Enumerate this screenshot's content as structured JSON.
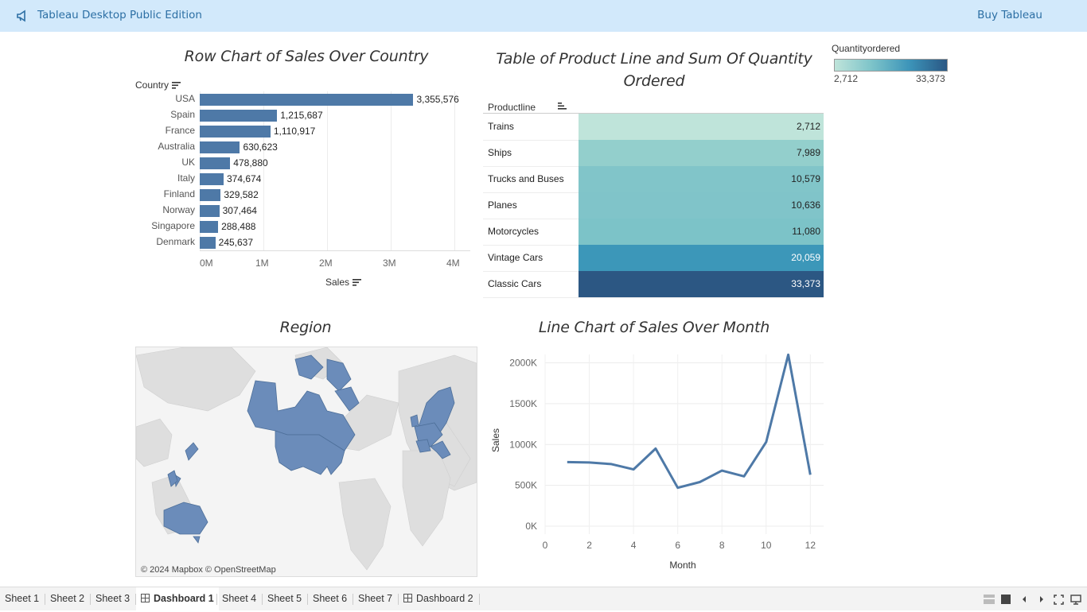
{
  "app": {
    "title": "Tableau Desktop Public Edition",
    "buy_label": "Buy Tableau",
    "brand_icon": "megaphone-icon"
  },
  "bar_chart": {
    "title": "Row Chart of Sales Over Country",
    "row_header": "Country",
    "x_label": "Sales",
    "ticks": [
      "0M",
      "1M",
      "2M",
      "3M",
      "4M"
    ]
  },
  "table": {
    "title_line1": "Table of Product Line and Sum Of Quantity",
    "title_line2": "Ordered",
    "column_header": "Productline",
    "legend_title": "Quantityordered",
    "legend_min": "2,712",
    "legend_max": "33,373"
  },
  "map": {
    "title": "Region",
    "credit": "© 2024 Mapbox © OpenStreetMap",
    "highlight_color": "#6b8cba"
  },
  "line_chart": {
    "title": "Line Chart of Sales Over Month",
    "x_label": "Month",
    "y_label": "Sales",
    "y_ticks": [
      "2000K",
      "1500K",
      "1000K",
      "500K",
      "0K"
    ],
    "x_ticks": [
      "0",
      "2",
      "4",
      "6",
      "8",
      "10",
      "12"
    ]
  },
  "chart_data": [
    {
      "type": "bar",
      "orientation": "horizontal",
      "title": "Row Chart of Sales Over Country",
      "xlabel": "Sales",
      "ylabel": "Country",
      "xlim": [
        0,
        4000000
      ],
      "categories": [
        "USA",
        "Spain",
        "France",
        "Australia",
        "UK",
        "Italy",
        "Finland",
        "Norway",
        "Singapore",
        "Denmark"
      ],
      "values": [
        3355576,
        1215687,
        1110917,
        630623,
        478880,
        374674,
        329582,
        307464,
        288488,
        245637
      ],
      "labels": [
        "3,355,576",
        "1,215,687",
        "1,110,917",
        "630,623",
        "478,880",
        "374,674",
        "329,582",
        "307,464",
        "288,488",
        "245,637"
      ],
      "color": "#4e79a7"
    },
    {
      "type": "table",
      "title": "Table of Product Line and Sum Of Quantity Ordered",
      "columns": [
        "Productline",
        "Quantityordered"
      ],
      "rows": [
        {
          "name": "Trains",
          "value": 2712,
          "label": "2,712",
          "color": "#bfe4da"
        },
        {
          "name": "Ships",
          "value": 7989,
          "label": "7,989",
          "color": "#93cfcc"
        },
        {
          "name": "Trucks and Buses",
          "value": 10579,
          "label": "10,579",
          "color": "#81c5c9"
        },
        {
          "name": "Planes",
          "value": 10636,
          "label": "10,636",
          "color": "#80c4c9"
        },
        {
          "name": "Motorcycles",
          "value": 11080,
          "label": "11,080",
          "color": "#7cc3c8"
        },
        {
          "name": "Vintage Cars",
          "value": 20059,
          "label": "20,059",
          "color": "#3c97b9"
        },
        {
          "name": "Classic Cars",
          "value": 33373,
          "label": "33,373",
          "color": "#2c5783"
        }
      ]
    },
    {
      "type": "line",
      "title": "Line Chart of Sales Over Month",
      "xlabel": "Month",
      "ylabel": "Sales",
      "xlim": [
        0,
        12.6
      ],
      "ylim": [
        0,
        2200000
      ],
      "x": [
        1,
        2,
        3,
        4,
        5,
        6,
        7,
        8,
        9,
        10,
        11,
        12
      ],
      "values": [
        785000,
        780000,
        760000,
        695000,
        950000,
        470000,
        540000,
        680000,
        610000,
        1030000,
        2100000,
        630000
      ],
      "color": "#4e79a7"
    }
  ],
  "tabs": [
    {
      "label": "Sheet 1",
      "type": "sheet",
      "active": false
    },
    {
      "label": "Sheet 2",
      "type": "sheet",
      "active": false
    },
    {
      "label": "Sheet 3",
      "type": "sheet",
      "active": false
    },
    {
      "label": "Dashboard 1",
      "type": "dashboard",
      "active": true
    },
    {
      "label": "Sheet 4",
      "type": "sheet",
      "active": false
    },
    {
      "label": "Sheet 5",
      "type": "sheet",
      "active": false
    },
    {
      "label": "Sheet 6",
      "type": "sheet",
      "active": false
    },
    {
      "label": "Sheet 7",
      "type": "sheet",
      "active": false
    },
    {
      "label": "Dashboard 2",
      "type": "dashboard",
      "active": false
    }
  ],
  "controls": [
    "view-toggle-icon",
    "square-icon",
    "previous-icon",
    "next-icon",
    "fullscreen-icon",
    "presentation-icon"
  ]
}
